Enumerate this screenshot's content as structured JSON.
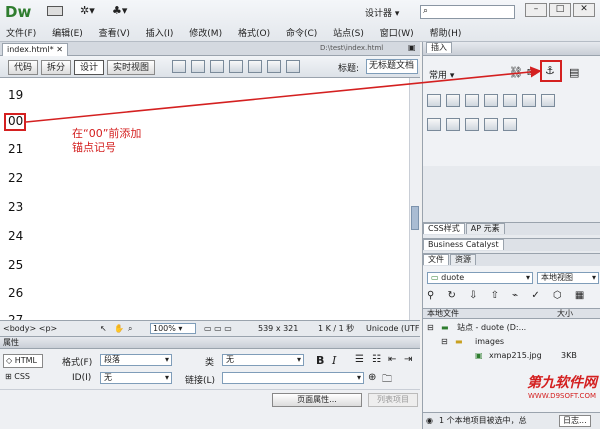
{
  "app": {
    "logo": "Dw",
    "workspace": "设计器",
    "search_placeholder": ""
  },
  "menu": [
    "文件(F)",
    "编辑(E)",
    "查看(V)",
    "插入(I)",
    "修改(M)",
    "格式(O)",
    "命令(C)",
    "站点(S)",
    "窗口(W)",
    "帮助(H)"
  ],
  "document": {
    "tab": "index.html*",
    "path": "D:\\test\\index.html"
  },
  "view_buttons": [
    "代码",
    "拆分",
    "设计",
    "实时视图"
  ],
  "title_label": "标题:",
  "title_value": "无标题文档",
  "line_numbers": [
    "19",
    "00",
    "21",
    "22",
    "23",
    "24",
    "25",
    "26",
    "27"
  ],
  "annotation": "在“00”前添加锚点记号",
  "status": {
    "tag": "<body> <p>",
    "zoom": "100%",
    "size": "539 x 321",
    "doc": "1 K / 1 秒",
    "encoding": "Unicode (UTF"
  },
  "properties": {
    "title": "属性",
    "html": "HTML",
    "css": "CSS",
    "format_label": "格式(F)",
    "format_value": "段落",
    "class_label": "类",
    "class_value": "无",
    "id_label": "ID(I)",
    "id_value": "无",
    "link_label": "链接(L)",
    "bold": "B",
    "italic": "I",
    "page_props": "页面属性...",
    "list_item": "列表项目"
  },
  "insert_panel": {
    "header": "插入",
    "category": "常用"
  },
  "css_tabs": [
    "CSS样式",
    "AP 元素"
  ],
  "bc_tab": "Business Catalyst",
  "files_tabs": [
    "文件",
    "资源"
  ],
  "files": {
    "site": "duote",
    "view": "本地视图",
    "col_local": "本地文件",
    "col_size": "大小",
    "rows": [
      {
        "name": "站点 - duote (D:...",
        "size": ""
      },
      {
        "name": "images",
        "size": ""
      },
      {
        "name": "xmap215.jpg",
        "size": "3KB"
      }
    ],
    "status": "1 个本地项目被选中，总",
    "log": "日志..."
  },
  "watermark": {
    "top": "第九软件网",
    "bottom": "WWW.D9SOFT.COM"
  },
  "colors": {
    "accent_red": "#d42020",
    "logo_green": "#2f7d2f",
    "panel_blue": "#c9ced6"
  }
}
